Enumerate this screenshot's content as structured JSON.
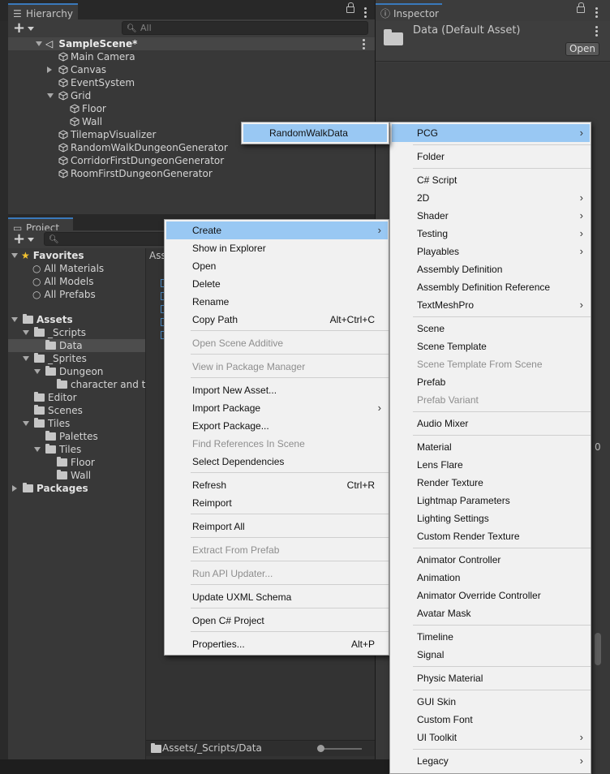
{
  "hierarchy": {
    "tab_label": "Hierarchy",
    "search_placeholder": "All",
    "scene": "SampleScene*",
    "items": [
      {
        "label": "Main Camera"
      },
      {
        "label": "Canvas"
      },
      {
        "label": "EventSystem"
      },
      {
        "label": "Grid"
      },
      {
        "label": "Floor"
      },
      {
        "label": "Wall"
      },
      {
        "label": "TilemapVisualizer"
      },
      {
        "label": "RandomWalkDungeonGenerator"
      },
      {
        "label": "CorridorFirstDungeonGenerator"
      },
      {
        "label": "RoomFirstDungeonGenerator"
      }
    ]
  },
  "inspector": {
    "tab_label": "Inspector",
    "asset_title": "Data (Default Asset)",
    "open_button": "Open"
  },
  "project": {
    "tab_label": "Project",
    "assets_header": "Ass",
    "favorites": {
      "label": "Favorites",
      "items": [
        {
          "label": "All Materials"
        },
        {
          "label": "All Models"
        },
        {
          "label": "All Prefabs"
        }
      ]
    },
    "tree": [
      {
        "label": "Assets"
      },
      {
        "label": "_Scripts"
      },
      {
        "label": "Data"
      },
      {
        "label": "_Sprites"
      },
      {
        "label": "Dungeon"
      },
      {
        "label": "character and til"
      },
      {
        "label": "Editor"
      },
      {
        "label": "Scenes"
      },
      {
        "label": "Tiles"
      },
      {
        "label": "Palettes"
      },
      {
        "label": "Tiles"
      },
      {
        "label": "Floor"
      },
      {
        "label": "Wall"
      },
      {
        "label": "Packages"
      }
    ],
    "path": "Assets/_Scripts/Data"
  },
  "context_menu": {
    "items": [
      {
        "label": "Create",
        "submenu": true,
        "selected": true
      },
      {
        "label": "Show in Explorer"
      },
      {
        "label": "Open"
      },
      {
        "label": "Delete"
      },
      {
        "label": "Rename"
      },
      {
        "label": "Copy Path",
        "shortcut": "Alt+Ctrl+C"
      },
      {
        "label": "Open Scene Additive",
        "disabled": true
      },
      {
        "label": "View in Package Manager",
        "disabled": true
      },
      {
        "label": "Import New Asset..."
      },
      {
        "label": "Import Package",
        "submenu": true
      },
      {
        "label": "Export Package..."
      },
      {
        "label": "Find References In Scene",
        "disabled": true
      },
      {
        "label": "Select Dependencies"
      },
      {
        "label": "Refresh",
        "shortcut": "Ctrl+R"
      },
      {
        "label": "Reimport"
      },
      {
        "label": "Reimport All"
      },
      {
        "label": "Extract From Prefab",
        "disabled": true
      },
      {
        "label": "Run API Updater...",
        "disabled": true
      },
      {
        "label": "Update UXML Schema"
      },
      {
        "label": "Open C# Project"
      },
      {
        "label": "Properties...",
        "shortcut": "Alt+P"
      }
    ]
  },
  "create_menu": {
    "items": [
      {
        "label": "PCG",
        "submenu": true,
        "selected": true
      },
      {
        "label": "Folder"
      },
      {
        "label": "C# Script"
      },
      {
        "label": "2D",
        "submenu": true
      },
      {
        "label": "Shader",
        "submenu": true
      },
      {
        "label": "Testing",
        "submenu": true
      },
      {
        "label": "Playables",
        "submenu": true
      },
      {
        "label": "Assembly Definition"
      },
      {
        "label": "Assembly Definition Reference"
      },
      {
        "label": "TextMeshPro",
        "submenu": true
      },
      {
        "label": "Scene"
      },
      {
        "label": "Scene Template"
      },
      {
        "label": "Scene Template From Scene",
        "disabled": true
      },
      {
        "label": "Prefab"
      },
      {
        "label": "Prefab Variant",
        "disabled": true
      },
      {
        "label": "Audio Mixer"
      },
      {
        "label": "Material"
      },
      {
        "label": "Lens Flare"
      },
      {
        "label": "Render Texture"
      },
      {
        "label": "Lightmap Parameters"
      },
      {
        "label": "Lighting Settings"
      },
      {
        "label": "Custom Render Texture"
      },
      {
        "label": "Animator Controller"
      },
      {
        "label": "Animation"
      },
      {
        "label": "Animator Override Controller"
      },
      {
        "label": "Avatar Mask"
      },
      {
        "label": "Timeline"
      },
      {
        "label": "Signal"
      },
      {
        "label": "Physic Material"
      },
      {
        "label": "GUI Skin"
      },
      {
        "label": "Custom Font"
      },
      {
        "label": "UI Toolkit",
        "submenu": true
      },
      {
        "label": "Legacy",
        "submenu": true
      }
    ]
  },
  "pcg_menu": {
    "items": [
      {
        "label": "RandomWalkData",
        "selected": true
      }
    ]
  },
  "right_edge": {
    "value": "0"
  },
  "colors": {
    "selection": "#99c8f3",
    "menu_bg": "#f1f1f1",
    "panel_bg": "#383838",
    "tab_accent": "#3a79bb"
  }
}
